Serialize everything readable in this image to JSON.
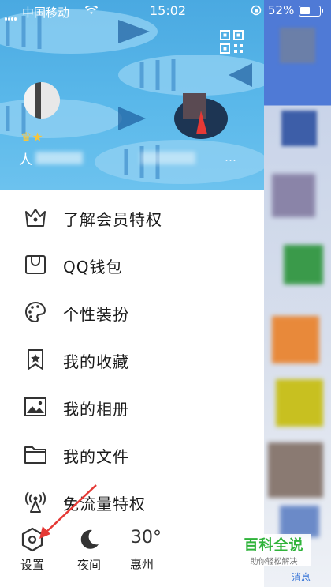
{
  "status_bar": {
    "carrier": "中国移动",
    "time": "15:02",
    "battery_percent": "52%",
    "battery_level": 0.52
  },
  "profile": {
    "nickname": "人",
    "signature_tail": "…"
  },
  "menu": [
    {
      "label": "了解会员特权",
      "icon": "crown-icon"
    },
    {
      "label": "QQ钱包",
      "icon": "wallet-icon"
    },
    {
      "label": "个性装扮",
      "icon": "palette-icon"
    },
    {
      "label": "我的收藏",
      "icon": "bookmark-star-icon"
    },
    {
      "label": "我的相册",
      "icon": "photo-icon"
    },
    {
      "label": "我的文件",
      "icon": "folder-icon"
    },
    {
      "label": "免流量特权",
      "icon": "antenna-icon"
    }
  ],
  "bottom_bar": {
    "settings_label": "设置",
    "night_label": "夜间",
    "temperature": "30°",
    "city": "惠州"
  },
  "watermark": {
    "title": "百科全说",
    "subtitle": "助你轻松解决"
  },
  "right_tab": {
    "label": "消息"
  },
  "colors": {
    "header_blue": "#4aa9e1",
    "accent_red": "#e53935",
    "watermark_green": "#2fb33a",
    "tab_blue": "#2f6fd6"
  }
}
